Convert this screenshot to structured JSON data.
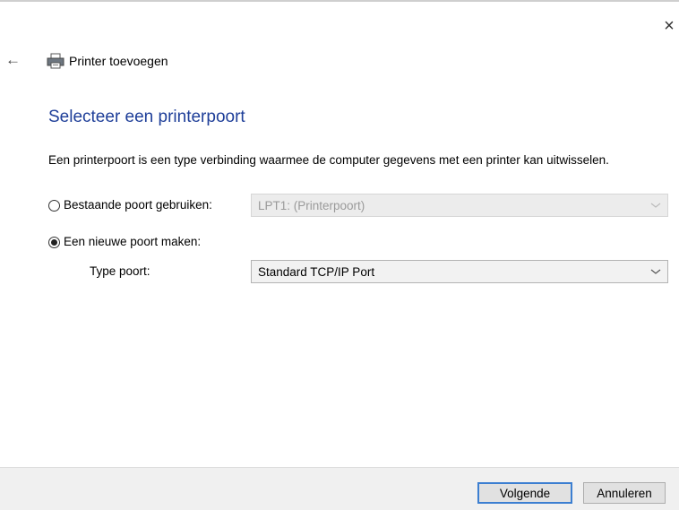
{
  "window": {
    "close_glyph": "×"
  },
  "header": {
    "back_glyph": "←",
    "title": "Printer toevoegen",
    "icon": "printer-icon"
  },
  "page": {
    "title": "Selecteer een printerpoort",
    "description": "Een printerpoort is een type verbinding waarmee de computer gegevens met een printer kan uitwisselen."
  },
  "options": {
    "existing": {
      "label": "Bestaande poort gebruiken:",
      "checked": false,
      "select_value": "LPT1: (Printerpoort)",
      "disabled": true
    },
    "new": {
      "label": "Een nieuwe poort maken:",
      "checked": true,
      "type_label": "Type poort:",
      "select_value": "Standard TCP/IP Port"
    }
  },
  "footer": {
    "next_label": "Volgende",
    "cancel_label": "Annuleren"
  },
  "colors": {
    "title": "#1f3f99",
    "primary_border": "#3c7fd1",
    "footer_bg": "#f0f0f0"
  }
}
